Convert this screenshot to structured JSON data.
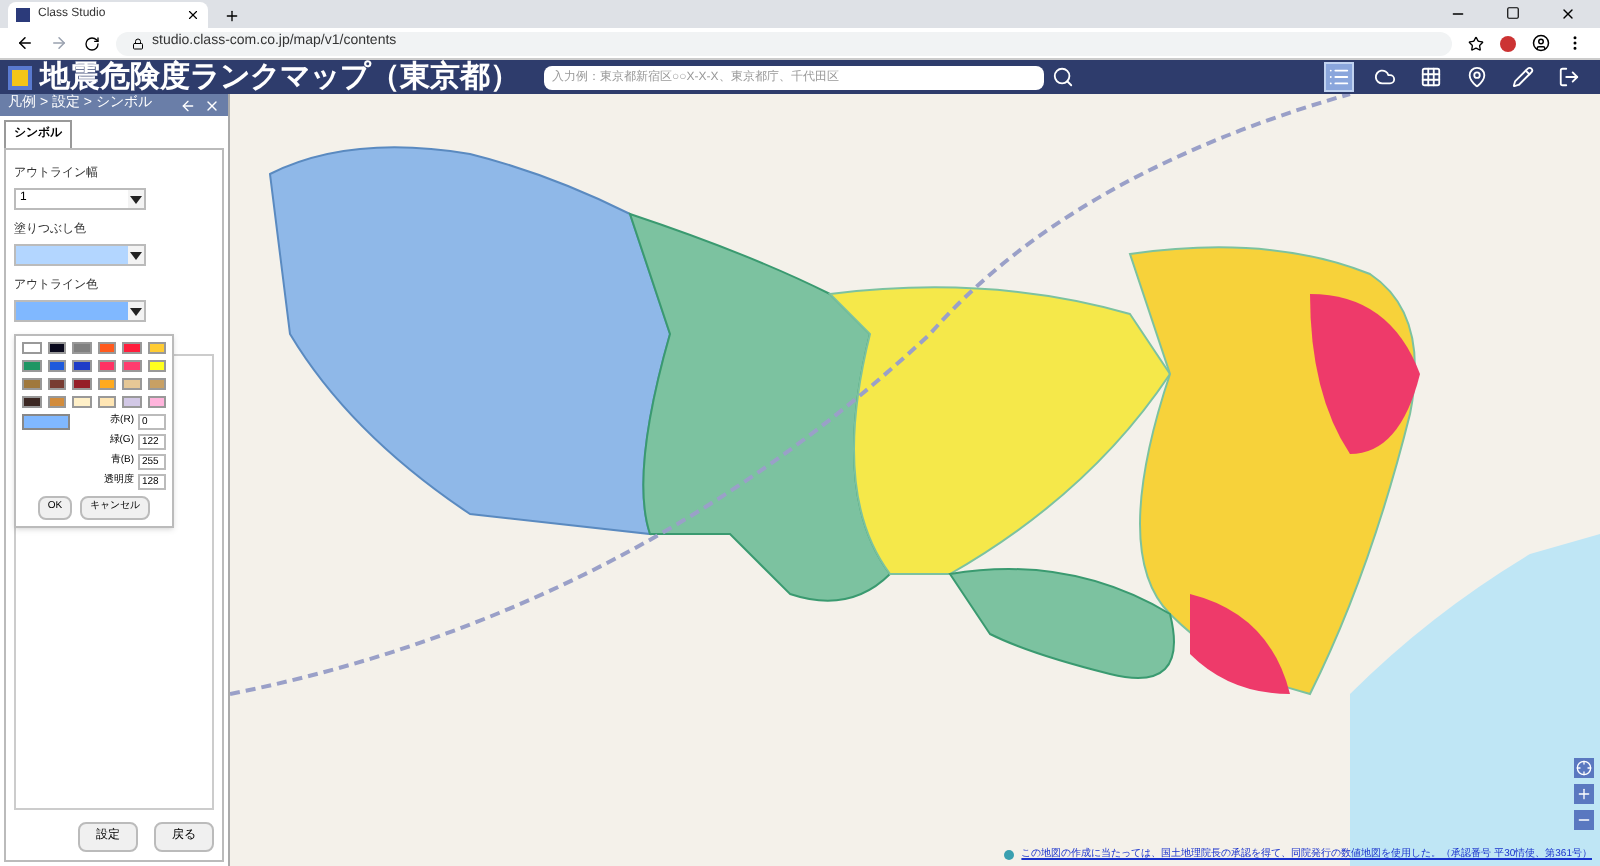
{
  "browser": {
    "tab_title": "Class Studio",
    "url": "studio.class-com.co.jp/map/v1/contents"
  },
  "header": {
    "title": "地震危険度ランクマップ（東京都）",
    "search_placeholder": "入力例：東京都新宿区○○X-X-X、東京都庁、千代田区",
    "tools": [
      {
        "kind": "list",
        "selected": true
      },
      {
        "kind": "cloud",
        "selected": false
      },
      {
        "kind": "grid",
        "selected": false
      },
      {
        "kind": "pin",
        "selected": false
      },
      {
        "kind": "pencil",
        "selected": false
      },
      {
        "kind": "exit",
        "selected": false
      }
    ]
  },
  "panel": {
    "breadcrumb": "凡例 > 設定 > シンボル",
    "tabs": [
      {
        "label": "シンボル",
        "selected": true
      }
    ],
    "fields": [
      {
        "label": "アウトライン幅",
        "value": "1",
        "color": "#ffffff"
      },
      {
        "label": "塗りつぶし色",
        "color": "#b3d6ff"
      },
      {
        "label": "アウトライン色",
        "color": "#80b8ff"
      }
    ],
    "palette": {
      "swatches": [
        {
          "color": "#ffffff"
        },
        {
          "color": "#0a0a1e"
        },
        {
          "color": "#808080"
        },
        {
          "color": "#ff5a1e"
        },
        {
          "color": "#ff1e3c"
        },
        {
          "color": "#ffcc33"
        },
        {
          "color": "#1e9664"
        },
        {
          "color": "#1e5adc"
        },
        {
          "color": "#1e3cc8"
        },
        {
          "color": "#ff3264"
        },
        {
          "color": "#ff3c6e"
        },
        {
          "color": "#ffff1e"
        },
        {
          "color": "#a0783c"
        },
        {
          "color": "#783c32"
        },
        {
          "color": "#961e28"
        },
        {
          "color": "#ffaa1e"
        },
        {
          "color": "#e6c896"
        },
        {
          "color": "#c8a064"
        },
        {
          "color": "#3c2823"
        },
        {
          "color": "#d28c3c"
        },
        {
          "color": "#fff0c8"
        },
        {
          "color": "#ffe6b4"
        },
        {
          "color": "#d2c8e6"
        },
        {
          "color": "#ffb4dc"
        }
      ],
      "preview": {
        "color": "#80b8ff"
      },
      "inputs": [
        {
          "label": "赤(R)",
          "value": "0"
        },
        {
          "label": "緑(G)",
          "value": "122"
        },
        {
          "label": "青(B)",
          "value": "255"
        },
        {
          "label": "透明度",
          "value": "128"
        }
      ],
      "buttons": [
        "OK",
        "キャンセル"
      ]
    },
    "buttons": [
      "設定",
      "戻る"
    ]
  },
  "map": {
    "attribution": "この地図の作成に当たっては、国土地理院長の承認を得て、同院発行の数値地図を使用した。（承認番号 平30情使、第361号）"
  }
}
